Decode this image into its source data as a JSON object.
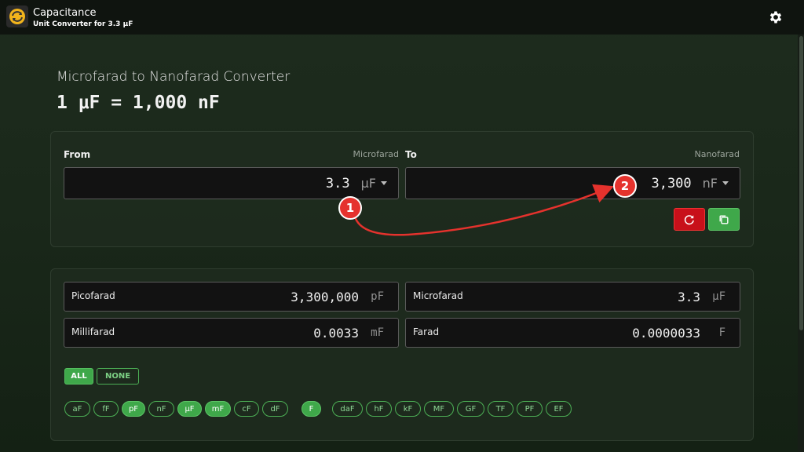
{
  "header": {
    "title": "Capacitance",
    "subtitle": "Unit Converter for 3.3 μF"
  },
  "page": {
    "heading": "Microfarad to Nanofarad Converter",
    "equation": "1 μF = 1,000 nF"
  },
  "converter": {
    "from": {
      "label": "From",
      "unit_name": "Microfarad",
      "value": "3.3",
      "unit": "μF"
    },
    "to": {
      "label": "To",
      "unit_name": "Nanofarad",
      "value": "3,300",
      "unit": "nF"
    }
  },
  "results": [
    {
      "name": "Picofarad",
      "value": "3,300,000",
      "unit": "pF"
    },
    {
      "name": "Microfarad",
      "value": "3.3",
      "unit": "μF"
    },
    {
      "name": "Millifarad",
      "value": "0.0033",
      "unit": "mF"
    },
    {
      "name": "Farad",
      "value": "0.0000033",
      "unit": "F"
    }
  ],
  "selection": {
    "all_label": "ALL",
    "none_label": "NONE"
  },
  "chips": [
    {
      "label": "aF",
      "on": false
    },
    {
      "label": "fF",
      "on": false
    },
    {
      "label": "pF",
      "on": true
    },
    {
      "label": "nF",
      "on": false
    },
    {
      "label": "μF",
      "on": true
    },
    {
      "label": "mF",
      "on": true
    },
    {
      "label": "cF",
      "on": false
    },
    {
      "label": "dF",
      "on": false
    },
    {
      "label": "F",
      "on": true
    },
    {
      "label": "daF",
      "on": false
    },
    {
      "label": "hF",
      "on": false
    },
    {
      "label": "kF",
      "on": false
    },
    {
      "label": "MF",
      "on": false
    },
    {
      "label": "GF",
      "on": false
    },
    {
      "label": "TF",
      "on": false
    },
    {
      "label": "PF",
      "on": false
    },
    {
      "label": "EF",
      "on": false
    }
  ],
  "annotations": {
    "badge_1": "1",
    "badge_2": "2"
  },
  "colors": {
    "accent": "#3fa84a",
    "reset": "#c8101a",
    "annotation": "#e5322d"
  }
}
